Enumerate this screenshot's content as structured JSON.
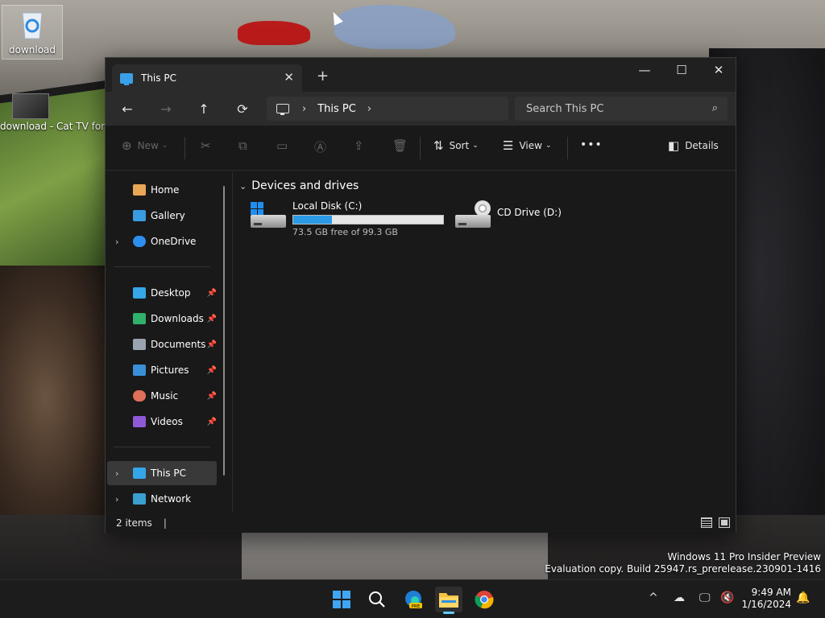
{
  "desktop": {
    "icons": [
      {
        "label": "download",
        "icon": "recycle-bin-icon"
      },
      {
        "label": "download - Cat TV for C",
        "icon": "image-thumbnail-icon"
      }
    ],
    "watermark": {
      "line1": "Windows 11 Pro Insider Preview",
      "line2": "Evaluation copy. Build 25947.rs_prerelease.230901-1416"
    }
  },
  "explorer": {
    "tab": {
      "title": "This PC",
      "icon": "this-pc-icon",
      "close": "✕"
    },
    "new_tab": "+",
    "window_controls": {
      "minimize": "—",
      "maximize": "☐",
      "close": "✕"
    },
    "nav": {
      "back": "←",
      "forward": "→",
      "up": "↑",
      "refresh": "⟳",
      "breadcrumb": [
        "This PC"
      ],
      "search_placeholder": "Search This PC"
    },
    "commands": {
      "new": "New",
      "sort": "Sort",
      "view": "View",
      "more": "•••",
      "details": "Details"
    },
    "sidebar": {
      "quick": [
        {
          "label": "Home",
          "icon": "home-icon",
          "color": "#e8a657",
          "expandable": false
        },
        {
          "label": "Gallery",
          "icon": "gallery-icon",
          "color": "#3a9be0",
          "expandable": false
        },
        {
          "label": "OneDrive",
          "icon": "onedrive-icon",
          "color": "#2c8ff0",
          "expandable": true
        }
      ],
      "pinned": [
        {
          "label": "Desktop",
          "icon": "desktop-folder-icon",
          "color": "#35a6e8"
        },
        {
          "label": "Downloads",
          "icon": "downloads-folder-icon",
          "color": "#2fb06b"
        },
        {
          "label": "Documents",
          "icon": "documents-folder-icon",
          "color": "#9aa3b0"
        },
        {
          "label": "Pictures",
          "icon": "pictures-folder-icon",
          "color": "#3a8fd8"
        },
        {
          "label": "Music",
          "icon": "music-folder-icon",
          "color": "#e0705a"
        },
        {
          "label": "Videos",
          "icon": "videos-folder-icon",
          "color": "#8e5ad8"
        }
      ],
      "locations": [
        {
          "label": "This PC",
          "icon": "this-pc-icon",
          "color": "#35a6e8",
          "selected": true
        },
        {
          "label": "Network",
          "icon": "network-icon",
          "color": "#3aa0d0",
          "selected": false
        }
      ]
    },
    "content": {
      "group_label": "Devices and drives",
      "drives": [
        {
          "name": "Local Disk (C:)",
          "free_text": "73.5 GB free of 99.3 GB",
          "used_fraction": 0.26,
          "icon": "hard-drive-icon"
        },
        {
          "name": "CD Drive (D:)",
          "icon": "cd-drive-icon"
        }
      ]
    },
    "status": {
      "count": "2 items"
    }
  },
  "taskbar": {
    "apps": [
      {
        "name": "Start",
        "icon": "windows-start-icon"
      },
      {
        "name": "Search",
        "icon": "search-icon"
      },
      {
        "name": "Microsoft Edge Canary",
        "icon": "edge-pre-icon",
        "badge": "PRE"
      },
      {
        "name": "File Explorer",
        "icon": "file-explorer-icon",
        "active": true
      },
      {
        "name": "Google Chrome",
        "icon": "chrome-icon"
      }
    ],
    "clock": {
      "time": "9:49 AM",
      "date": "1/16/2024"
    },
    "colors": {
      "accent": "#60cdff",
      "window_bg": "#191919",
      "selection": "#393939"
    }
  }
}
